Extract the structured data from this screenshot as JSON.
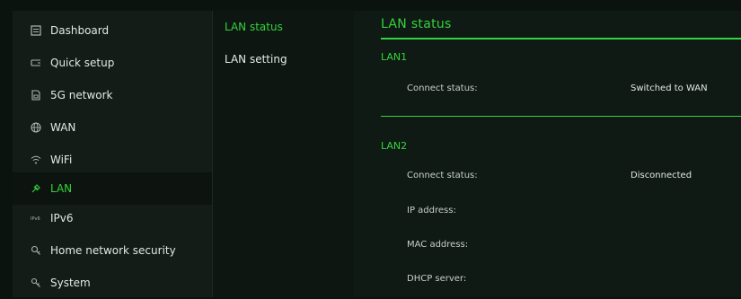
{
  "sidebar": {
    "items": [
      {
        "label": "Dashboard",
        "icon": "dashboard-icon",
        "active": false
      },
      {
        "label": "Quick setup",
        "icon": "quick-setup-icon",
        "active": false
      },
      {
        "label": "5G network",
        "icon": "sim-card-icon",
        "active": false
      },
      {
        "label": "WAN",
        "icon": "globe-icon",
        "active": false
      },
      {
        "label": "WiFi",
        "icon": "wifi-icon",
        "active": false
      },
      {
        "label": "LAN",
        "icon": "lan-icon",
        "active": true
      },
      {
        "label": "IPv6",
        "icon": "ipv6-icon",
        "active": false
      },
      {
        "label": "Home network security",
        "icon": "security-icon",
        "active": false
      },
      {
        "label": "System",
        "icon": "system-icon",
        "active": false
      }
    ]
  },
  "submenu": {
    "items": [
      {
        "label": "LAN status",
        "active": true
      },
      {
        "label": "LAN setting",
        "active": false
      }
    ]
  },
  "main": {
    "title": "LAN status",
    "lan1": {
      "title": "LAN1",
      "connect_status_label": "Connect status:",
      "connect_status_value": "Switched to WAN"
    },
    "lan2": {
      "title": "LAN2",
      "connect_status_label": "Connect status:",
      "connect_status_value": "Disconnected",
      "ip_label": "IP address:",
      "mac_label": "MAC address:",
      "dhcp_label": "DHCP server:"
    }
  },
  "colors": {
    "accent": "#34d33c",
    "background": "#0b130f",
    "sidebar": "#131c17"
  }
}
